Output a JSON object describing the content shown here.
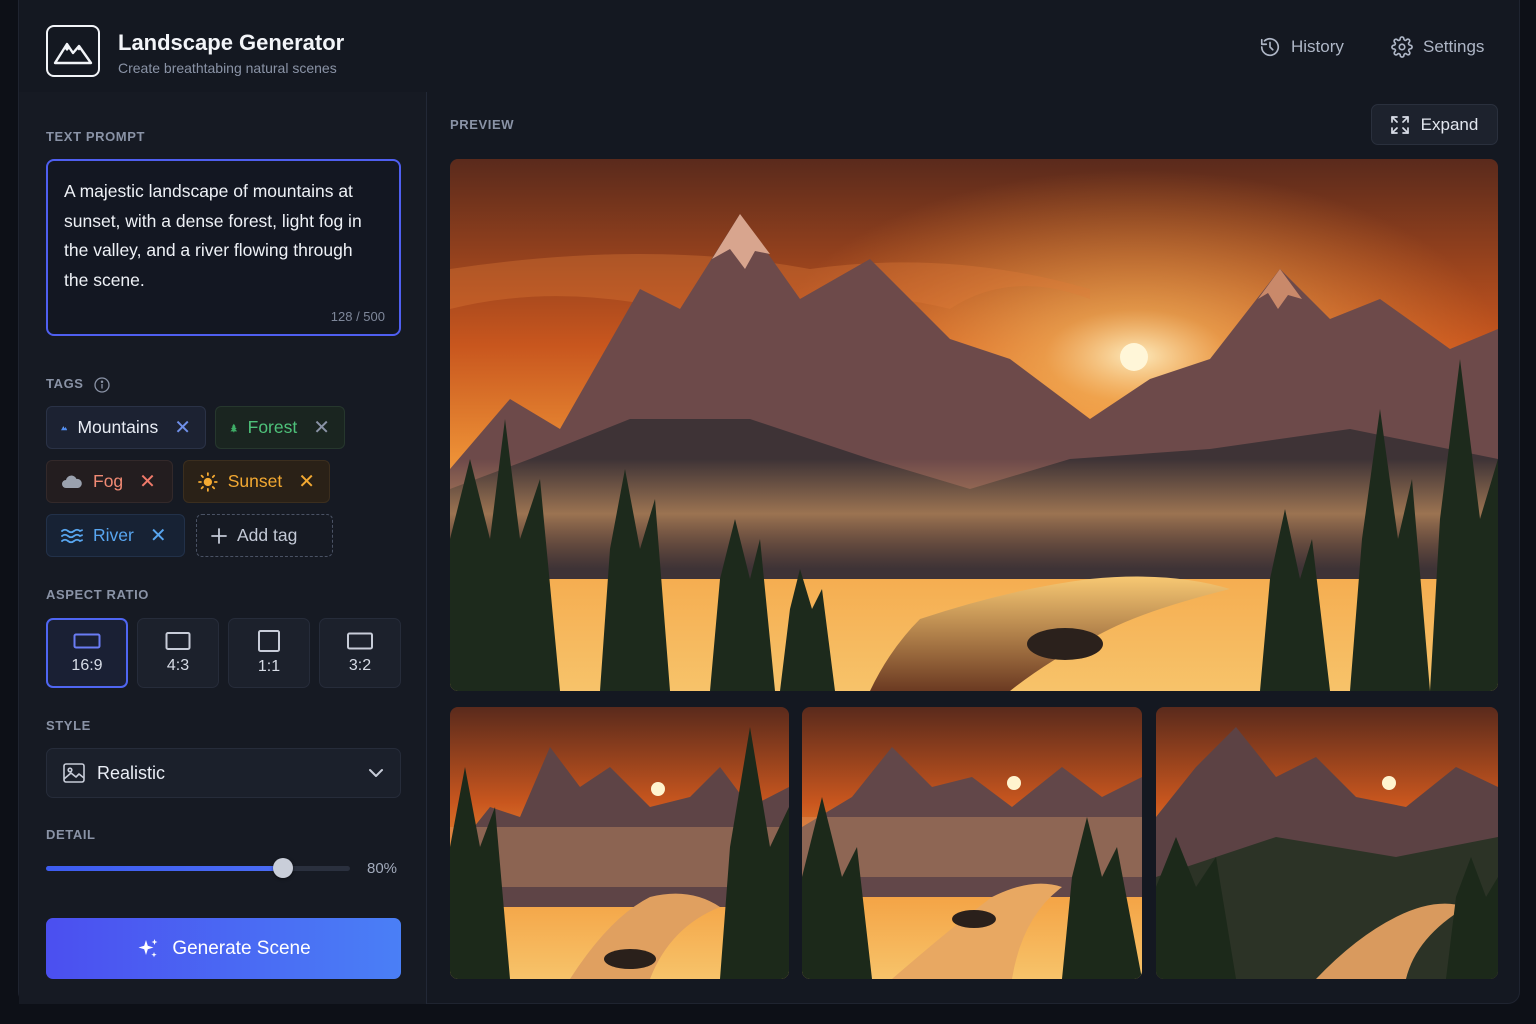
{
  "app": {
    "title": "Landscape Generator",
    "subtitle": "Create breathtabing natural scenes",
    "logo_icon": "mountain-logo-icon"
  },
  "header": {
    "history_label": "History",
    "settings_label": "Settings"
  },
  "prompt": {
    "section_label": "TEXT PROMPT",
    "value": "A majestic landscape of mountains at sunset, with a dense forest, light fog in the valley, and a river flowing through the scene.",
    "counter": "128 / 500"
  },
  "tags": {
    "section_label": "TAGS",
    "items": [
      {
        "label": "Mountains",
        "icon": "mountain-icon",
        "color": "#4f8cf0"
      },
      {
        "label": "Forest",
        "icon": "tree-icon",
        "color": "#4ec27a"
      },
      {
        "label": "Fog",
        "icon": "cloud-icon",
        "color": "#f08a74"
      },
      {
        "label": "Sunset",
        "icon": "sun-icon",
        "color": "#f3a932"
      },
      {
        "label": "River",
        "icon": "waves-icon",
        "color": "#58a6f0"
      }
    ],
    "add_label": "Add tag"
  },
  "aspect_ratio": {
    "section_label": "ASPECT RATIO",
    "options": [
      "16:9",
      "4:3",
      "1:1",
      "3:2"
    ],
    "selected": "16:9"
  },
  "style": {
    "section_label": "STYLE",
    "value": "Realistic"
  },
  "detail": {
    "section_label": "DETAIL",
    "value_text": "80%",
    "value": 0.8
  },
  "generate": {
    "label": "Generate Scene",
    "gradient": [
      "#4b4ff0",
      "#4a7ff6"
    ]
  },
  "preview": {
    "section_label": "PREVIEW",
    "expand_label": "Expand"
  },
  "colors": {
    "accent": "#4f5ff0",
    "background": "#0d1017",
    "panel": "#141821"
  }
}
